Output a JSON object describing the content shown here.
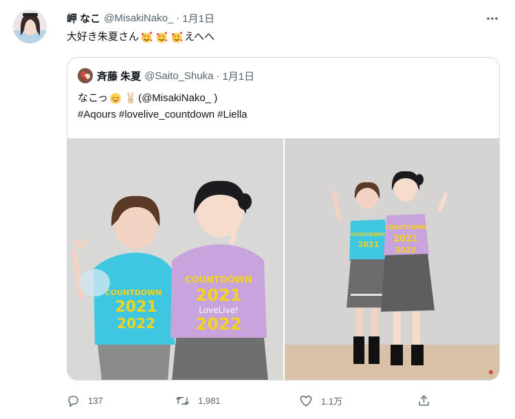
{
  "tweet": {
    "display_name": "岬 なこ",
    "handle": "@MisakiNako_",
    "separator": "·",
    "date": "1月1日",
    "text_main": "大好き朱夏さん",
    "text_tail": "えへへ",
    "emoji_icon": "smiling-face-with-hearts"
  },
  "quoted": {
    "display_name": "斉藤 朱夏",
    "handle": "@Saito_Shuka",
    "separator": "·",
    "date": "1月1日",
    "line1_text": "なこっ",
    "line1_mention": "(@MisakiNako_ )",
    "hashtags": [
      "#Aqours",
      "#lovelive_countdown",
      "#Liella"
    ],
    "photo1_shirt1": "COUNTDOWN 2021 2022",
    "photo1_shirt2": "COUNTDOWN 2021 LoveLive! 2022",
    "photo2_shirt": "COUNTDOWN 2021 2022"
  },
  "actions": {
    "reply_count": "137",
    "retweet_count": "1,981",
    "like_count": "1.1万"
  },
  "colors": {
    "text": "#0f1419",
    "muted": "#536471",
    "border": "#cfd9de",
    "teal_shirt": "#3fc6e0",
    "lilac_shirt": "#c8a4dc",
    "shirt_text": "#f5d21e"
  }
}
